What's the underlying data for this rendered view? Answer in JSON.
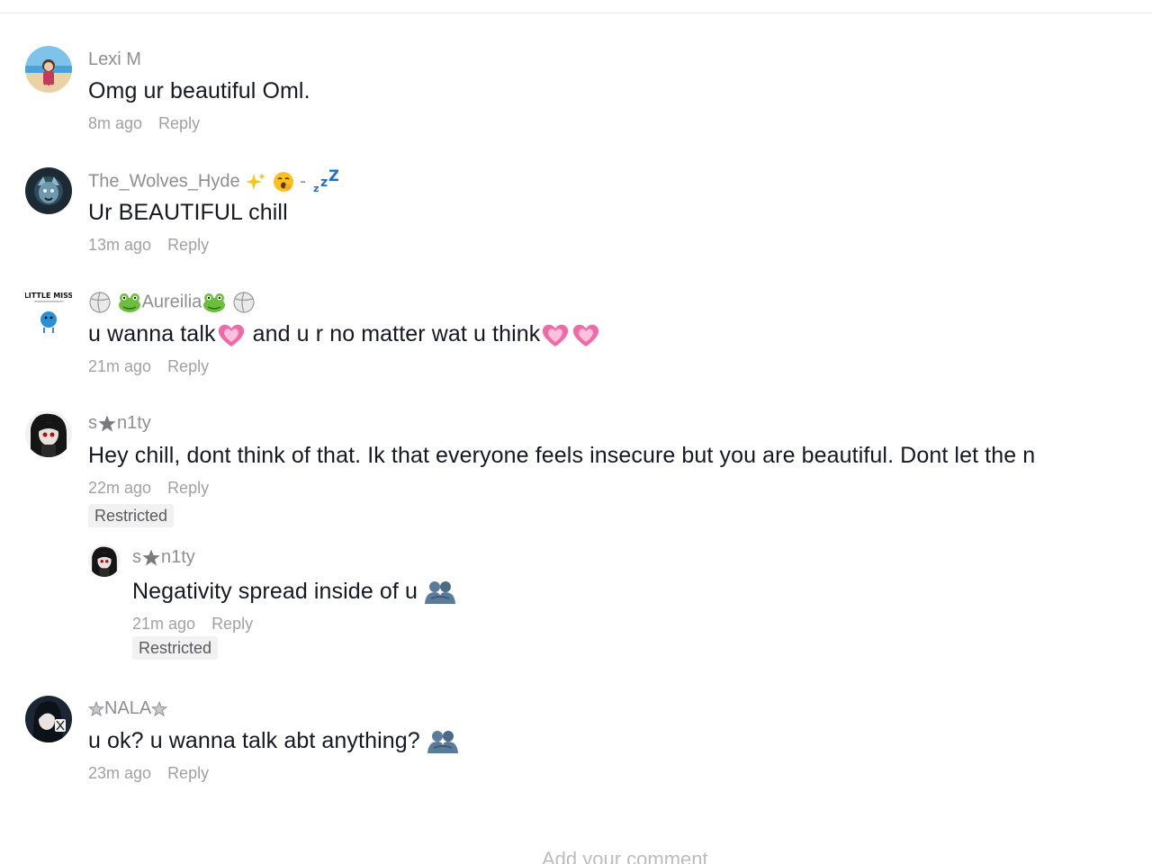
{
  "comments": [
    {
      "username": "Lexi M",
      "text": "Omg ur beautiful Oml.",
      "time": "8m ago",
      "reply_label": "Reply"
    },
    {
      "username": "The_Wolves_Hyde",
      "username_suffix": "-",
      "text": "Ur BEAUTIFUL chill",
      "time": "13m ago",
      "reply_label": "Reply"
    },
    {
      "username": "Aureilia",
      "text_part1": "u wanna talk",
      "text_part2": " and u r no matter wat u think",
      "time": "21m ago",
      "reply_label": "Reply"
    },
    {
      "username_prefix": "s",
      "username_suffix": "n1ty",
      "text": "Hey chill, dont think of that. Ik that everyone feels insecure but you are beautiful. Dont let the n",
      "time": "22m ago",
      "reply_label": "Reply",
      "badge": "Restricted",
      "replies": [
        {
          "username_prefix": "s",
          "username_suffix": "n1ty",
          "text": "Negativity spread inside of u",
          "time": "21m ago",
          "reply_label": "Reply",
          "badge": "Restricted"
        }
      ]
    },
    {
      "username": "NALA",
      "text": "u ok? u wanna talk abt anything?",
      "time": "23m ago",
      "reply_label": "Reply"
    }
  ],
  "composer": {
    "placeholder": "Add your comment"
  },
  "avatar_logo_text": "LITTLE MISS"
}
